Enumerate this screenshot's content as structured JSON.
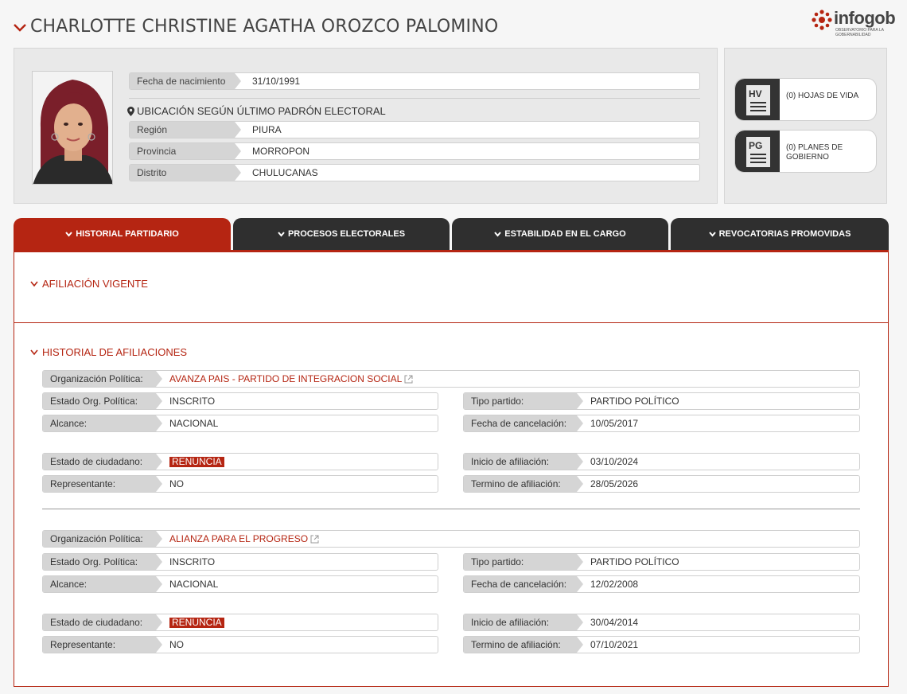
{
  "header": {
    "name": "CHARLOTTE CHRISTINE AGATHA OROZCO PALOMINO",
    "logo_word": "infogob",
    "logo_sub": "OBSERVATORIO PARA LA GOBERNABILIDAD"
  },
  "person": {
    "birth_label": "Fecha de nacimiento",
    "birth_value": "31/10/1991",
    "location_title": "UBICACIÓN SEGÚN ÚLTIMO PADRÓN ELECTORAL",
    "region_label": "Región",
    "region_value": "PIURA",
    "province_label": "Provincia",
    "province_value": "MORROPON",
    "district_label": "Distrito",
    "district_value": "CHULUCANAS"
  },
  "docs": {
    "hv_abbr": "HV",
    "hv_text": "(0) HOJAS DE VIDA",
    "pg_abbr": "PG",
    "pg_text": "(0) PLANES DE GOBIERNO"
  },
  "tabs": [
    {
      "label": "HISTORIAL PARTIDARIO"
    },
    {
      "label": "PROCESOS ELECTORALES"
    },
    {
      "label": "ESTABILIDAD EN EL CARGO"
    },
    {
      "label": "REVOCATORIAS PROMOVIDAS"
    }
  ],
  "sections": {
    "current": "AFILIACIÓN VIGENTE",
    "history": "HISTORIAL DE AFILIACIONES"
  },
  "labels": {
    "org": "Organización Política:",
    "org_state": "Estado Org. Política:",
    "scope": "Alcance:",
    "citizen_state": "Estado de ciudadano:",
    "rep": "Representante:",
    "party_type": "Tipo partido:",
    "cancel_date": "Fecha de cancelación:",
    "start": "Inicio de afiliación:",
    "end": "Termino de afiliación:"
  },
  "affiliations": [
    {
      "org": "AVANZA PAIS - PARTIDO DE INTEGRACION SOCIAL",
      "org_state": "INSCRITO",
      "scope": "NACIONAL",
      "citizen_state": "RENUNCIA",
      "rep": "NO",
      "party_type": "PARTIDO POLÍTICO",
      "cancel_date": "10/05/2017",
      "start": "03/10/2024",
      "end": "28/05/2026"
    },
    {
      "org": "ALIANZA PARA EL PROGRESO",
      "org_state": "INSCRITO",
      "scope": "NACIONAL",
      "citizen_state": "RENUNCIA",
      "rep": "NO",
      "party_type": "PARTIDO POLÍTICO",
      "cancel_date": "12/02/2008",
      "start": "30/04/2014",
      "end": "07/10/2021"
    }
  ],
  "colors": {
    "accent": "#b52512",
    "tab_dark": "#2f2f2f"
  }
}
